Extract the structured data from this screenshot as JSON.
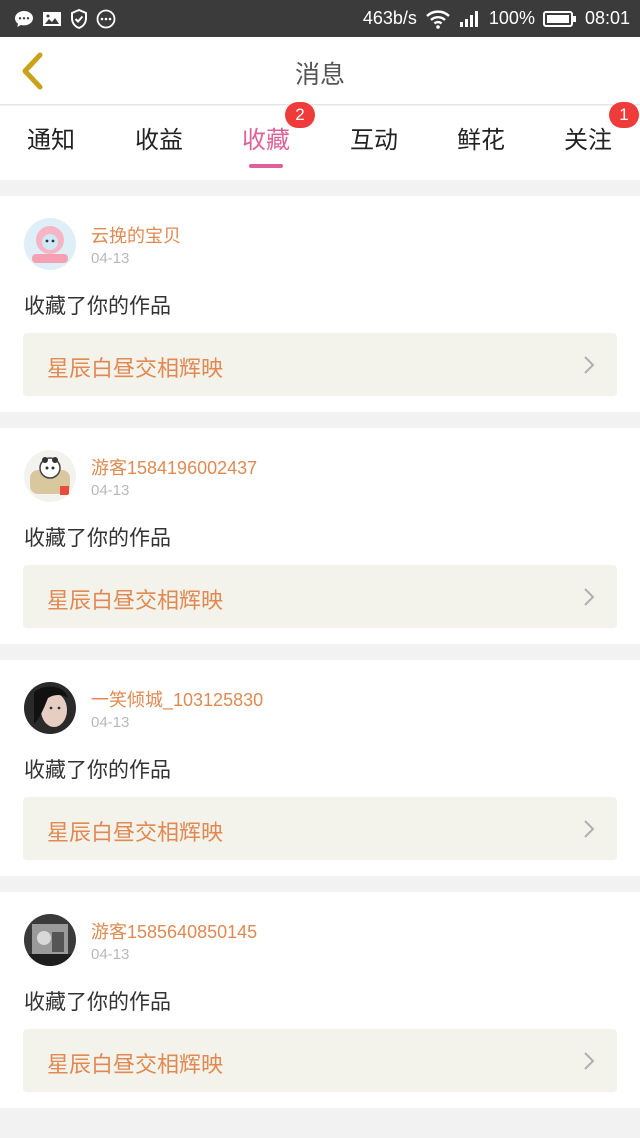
{
  "status_bar": {
    "speed": "463b/s",
    "battery": "100%",
    "time": "08:01"
  },
  "header": {
    "title": "消息"
  },
  "tabs": [
    {
      "label": "通知",
      "badge": ""
    },
    {
      "label": "收益",
      "badge": ""
    },
    {
      "label": "收藏",
      "badge": "2",
      "active": true
    },
    {
      "label": "互动",
      "badge": ""
    },
    {
      "label": "鲜花",
      "badge": ""
    },
    {
      "label": "关注",
      "badge": "1"
    }
  ],
  "accent_color": "#e0619a",
  "items": [
    {
      "user": "云挽的宝贝",
      "date": "04-13",
      "action": "收藏了你的作品",
      "work": "星辰白昼交相辉映"
    },
    {
      "user": "游客1584196002437",
      "date": "04-13",
      "action": "收藏了你的作品",
      "work": "星辰白昼交相辉映"
    },
    {
      "user": "一笑倾城_103125830",
      "date": "04-13",
      "action": "收藏了你的作品",
      "work": "星辰白昼交相辉映"
    },
    {
      "user": "游客1585640850145",
      "date": "04-13",
      "action": "收藏了你的作品",
      "work": "星辰白昼交相辉映"
    }
  ]
}
